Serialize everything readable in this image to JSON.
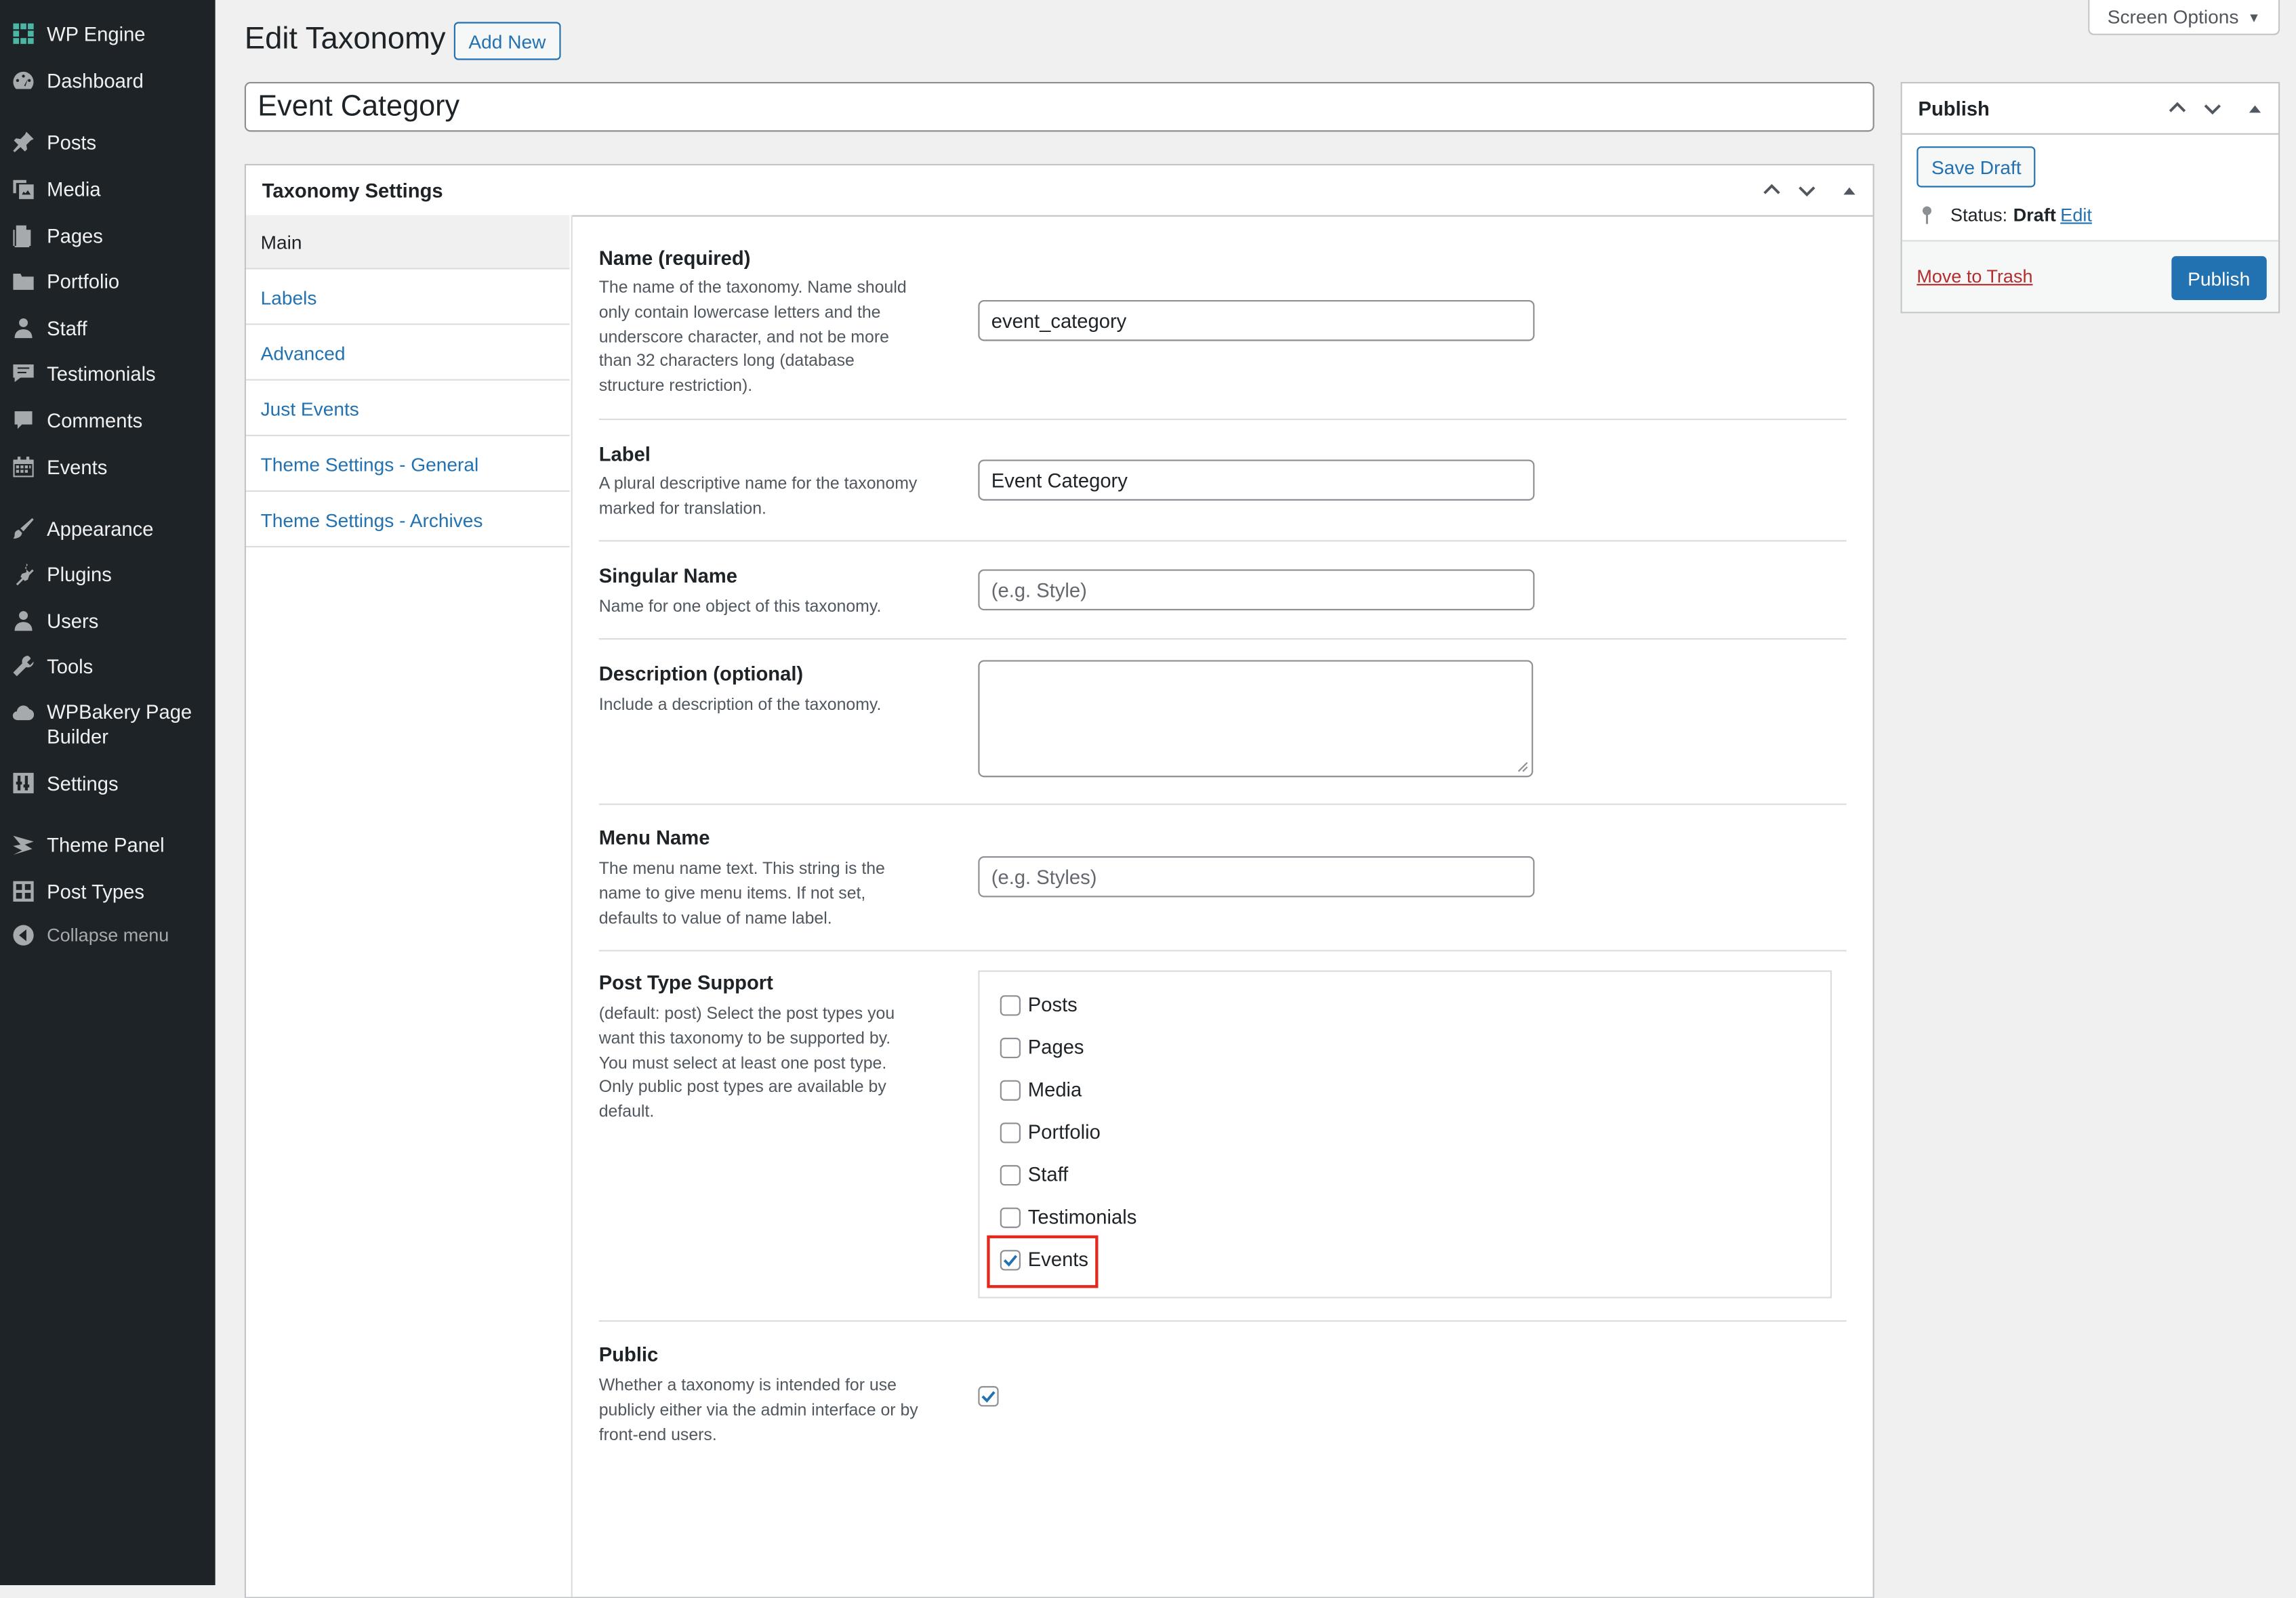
{
  "sidebar": {
    "items": [
      {
        "label": "WP Engine",
        "icon": "wp-engine-icon"
      },
      {
        "label": "Dashboard",
        "icon": "dashboard-icon"
      },
      {
        "label": "Posts",
        "icon": "pin-icon"
      },
      {
        "label": "Media",
        "icon": "media-icon"
      },
      {
        "label": "Pages",
        "icon": "pages-icon"
      },
      {
        "label": "Portfolio",
        "icon": "folder-icon"
      },
      {
        "label": "Staff",
        "icon": "user-icon"
      },
      {
        "label": "Testimonials",
        "icon": "testimonial-icon"
      },
      {
        "label": "Comments",
        "icon": "comment-icon"
      },
      {
        "label": "Events",
        "icon": "calendar-icon"
      },
      {
        "label": "Appearance",
        "icon": "brush-icon"
      },
      {
        "label": "Plugins",
        "icon": "plugin-icon"
      },
      {
        "label": "Users",
        "icon": "users-icon"
      },
      {
        "label": "Tools",
        "icon": "wrench-icon"
      },
      {
        "label": "WPBakery Page Builder",
        "icon": "cloud-icon"
      },
      {
        "label": "Settings",
        "icon": "settings-icon"
      },
      {
        "label": "Theme Panel",
        "icon": "theme-panel-icon"
      },
      {
        "label": "Post Types",
        "icon": "grid-icon"
      }
    ],
    "collapse_label": "Collapse menu"
  },
  "header": {
    "title": "Edit Taxonomy",
    "add_new": "Add New",
    "screen_options": "Screen Options",
    "title_value": "Event Category"
  },
  "settings_box": {
    "title": "Taxonomy Settings",
    "tabs": [
      "Main",
      "Labels",
      "Advanced",
      "Just Events",
      "Theme Settings - General",
      "Theme Settings - Archives"
    ],
    "fields": {
      "name": {
        "label": "Name (required)",
        "desc": "The name of the taxonomy. Name should only contain lowercase letters and the underscore character, and not be more than 32 characters long (database structure restriction).",
        "value": "event_category"
      },
      "label": {
        "label": "Label",
        "desc": "A plural descriptive name for the taxonomy marked for translation.",
        "value": "Event Category"
      },
      "singular": {
        "label": "Singular Name",
        "desc": "Name for one object of this taxonomy.",
        "placeholder": "(e.g. Style)"
      },
      "description": {
        "label": "Description (optional)",
        "desc": "Include a description of the taxonomy."
      },
      "menu_name": {
        "label": "Menu Name",
        "desc": "The menu name text. This string is the name to give menu items. If not set, defaults to value of name label.",
        "placeholder": "(e.g. Styles)"
      },
      "post_types": {
        "label": "Post Type Support",
        "desc": "(default: post) Select the post types you want this taxonomy to be supported by. You must select at least one post type. Only public post types are available by default.",
        "options": [
          {
            "label": "Posts",
            "checked": false
          },
          {
            "label": "Pages",
            "checked": false
          },
          {
            "label": "Media",
            "checked": false
          },
          {
            "label": "Portfolio",
            "checked": false
          },
          {
            "label": "Staff",
            "checked": false
          },
          {
            "label": "Testimonials",
            "checked": false
          },
          {
            "label": "Events",
            "checked": true
          }
        ]
      },
      "public": {
        "label": "Public",
        "desc": "Whether a taxonomy is intended for use publicly either via the admin interface or by front-end users.",
        "checked": true
      }
    }
  },
  "publish_box": {
    "title": "Publish",
    "save_draft": "Save Draft",
    "status_label": "Status:",
    "status_value": "Draft",
    "edit": "Edit",
    "trash": "Move to Trash",
    "publish": "Publish"
  },
  "colors": {
    "accent": "#2271b1",
    "sidebar_bg": "#1d2327",
    "highlight": "#e3291c"
  }
}
